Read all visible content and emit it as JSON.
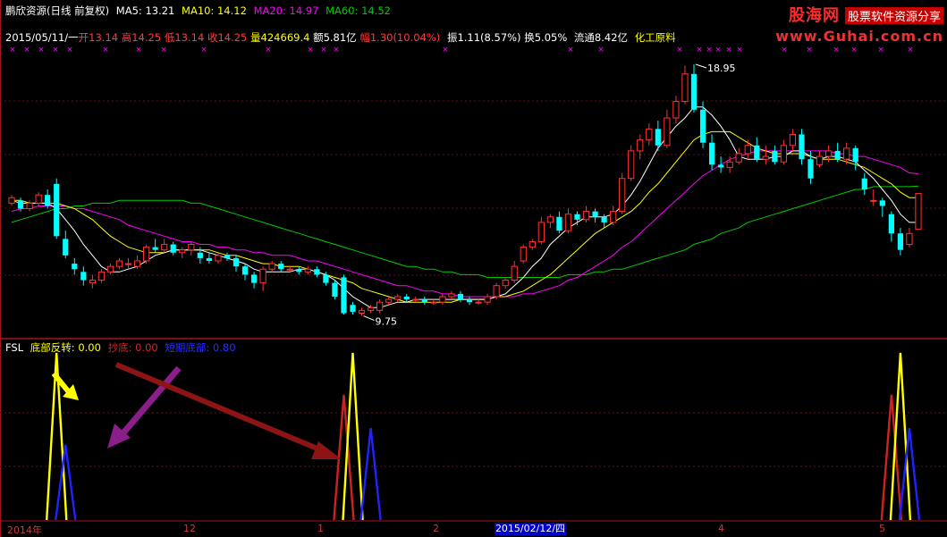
{
  "header": {
    "name": "鹏欣资源(日线 前复权)",
    "ma5_label": "MA5:",
    "ma5": "13.21",
    "ma10_label": "MA10:",
    "ma10": "14.12",
    "ma20_label": "MA20:",
    "ma20": "14.97",
    "ma60_label": "MA60:",
    "ma60": "14.52",
    "colors": {
      "ma5": "#ffffff",
      "ma10": "#ffff00",
      "ma20": "#ff00ff",
      "ma60": "#00cc00"
    }
  },
  "info": {
    "date": "2015/05/11/一",
    "open_label": "开",
    "open": "13.14",
    "high_label": "高",
    "high": "14.25",
    "low_label": "低",
    "low": "13.14",
    "close_label": "收",
    "close": "14.25",
    "vol_label": "量",
    "vol": "424669.4",
    "amt_label": "额",
    "amt": "5.81亿",
    "chg_label": "幅",
    "chg": "1.30(10.04%)",
    "amp_label": "振",
    "amp": "1.11(8.57%)",
    "turn_label": "换",
    "turn": "5.05%",
    "float_label": "流通",
    "float": "8.42亿",
    "sector": "化工原料"
  },
  "price_marks": {
    "high": "18.95",
    "low": "9.75"
  },
  "indicator": {
    "name": "FSL",
    "l1_label": "底部反转:",
    "l1": "0.00",
    "l2_label": "抄底:",
    "l2": "0.00",
    "l3_label": "短期底部:",
    "l3": "0.80",
    "colors": {
      "l1": "#ffff00",
      "l2": "#cc2222",
      "l3": "#2222ff"
    }
  },
  "watermark": {
    "brand": "股海网",
    "slogan": "股票软件资源分享",
    "url": "www.Guhai.com.cn"
  },
  "x_axis": {
    "labels": [
      {
        "text": "2014年",
        "x": 8
      },
      {
        "text": "12",
        "x": 205
      },
      {
        "text": "1",
        "x": 355
      },
      {
        "text": "2",
        "x": 484
      },
      {
        "text": "4",
        "x": 803
      },
      {
        "text": "5",
        "x": 983
      }
    ],
    "cursor_label": "2015/02/12/四"
  },
  "chart_data": {
    "type": "candlestick",
    "price_range": [
      9.2,
      19.6
    ],
    "candles": [
      [
        13.9,
        14.1,
        14.2,
        13.8
      ],
      [
        14.0,
        13.7,
        14.1,
        13.6
      ],
      [
        13.7,
        13.9,
        14.0,
        13.6
      ],
      [
        13.9,
        14.2,
        14.3,
        13.8
      ],
      [
        14.2,
        13.8,
        14.4,
        13.7
      ],
      [
        14.6,
        12.7,
        14.8,
        12.6
      ],
      [
        12.6,
        12.0,
        12.9,
        11.9
      ],
      [
        11.7,
        11.5,
        11.9,
        11.3
      ],
      [
        11.4,
        11.1,
        11.6,
        10.9
      ],
      [
        11.0,
        11.1,
        11.3,
        10.8
      ],
      [
        11.1,
        11.4,
        11.5,
        11.0
      ],
      [
        11.4,
        11.6,
        11.7,
        11.3
      ],
      [
        11.6,
        11.8,
        11.9,
        11.5
      ],
      [
        11.7,
        11.7,
        11.9,
        11.5
      ],
      [
        11.6,
        11.8,
        12.0,
        11.5
      ],
      [
        11.8,
        12.3,
        12.4,
        11.7
      ],
      [
        12.3,
        12.2,
        12.6,
        12.1
      ],
      [
        12.2,
        12.4,
        12.6,
        12.1
      ],
      [
        12.4,
        12.1,
        12.5,
        12.0
      ],
      [
        12.1,
        12.2,
        12.3,
        11.9
      ],
      [
        12.2,
        12.4,
        12.5,
        12.0
      ],
      [
        12.1,
        11.9,
        12.3,
        11.7
      ],
      [
        11.9,
        11.8,
        12.1,
        11.7
      ],
      [
        11.8,
        12.0,
        12.1,
        11.7
      ],
      [
        12.0,
        11.9,
        12.1,
        11.8
      ],
      [
        11.9,
        11.6,
        12.0,
        11.4
      ],
      [
        11.6,
        11.3,
        11.7,
        11.1
      ],
      [
        11.3,
        11.0,
        11.4,
        10.8
      ],
      [
        11.0,
        11.5,
        11.6,
        10.7
      ],
      [
        11.5,
        11.7,
        11.8,
        11.4
      ],
      [
        11.7,
        11.5,
        11.8,
        11.4
      ],
      [
        11.5,
        11.5,
        11.6,
        11.4
      ],
      [
        11.5,
        11.4,
        11.6,
        11.3
      ],
      [
        11.4,
        11.5,
        11.6,
        11.3
      ],
      [
        11.5,
        11.3,
        11.6,
        11.2
      ],
      [
        11.3,
        11.0,
        11.4,
        10.9
      ],
      [
        11.0,
        10.5,
        11.1,
        10.4
      ],
      [
        11.2,
        9.9,
        11.3,
        9.85
      ],
      [
        10.2,
        9.95,
        10.3,
        9.85
      ],
      [
        9.9,
        10.0,
        10.1,
        9.8
      ],
      [
        10.0,
        10.1,
        10.2,
        9.9
      ],
      [
        10.0,
        10.3,
        10.4,
        9.9
      ],
      [
        10.3,
        10.4,
        10.5,
        10.2
      ],
      [
        10.4,
        10.5,
        10.6,
        10.3
      ],
      [
        10.5,
        10.4,
        10.6,
        10.3
      ],
      [
        10.4,
        10.4,
        10.5,
        10.3
      ],
      [
        10.4,
        10.3,
        10.5,
        10.2
      ],
      [
        10.3,
        10.3,
        10.4,
        10.2
      ],
      [
        10.3,
        10.5,
        10.6,
        10.2
      ],
      [
        10.5,
        10.6,
        10.7,
        10.4
      ],
      [
        10.6,
        10.4,
        10.7,
        10.3
      ],
      [
        10.4,
        10.3,
        10.5,
        10.2
      ],
      [
        10.3,
        10.3,
        10.4,
        10.2
      ],
      [
        10.3,
        10.5,
        10.6,
        10.2
      ],
      [
        10.5,
        10.9,
        11.0,
        10.4
      ],
      [
        10.9,
        11.1,
        11.2,
        10.8
      ],
      [
        11.1,
        11.6,
        11.8,
        11.0
      ],
      [
        11.8,
        12.3,
        12.4,
        11.7
      ],
      [
        12.3,
        12.5,
        12.6,
        12.2
      ],
      [
        12.5,
        13.2,
        13.4,
        12.4
      ],
      [
        13.2,
        13.4,
        13.5,
        13.0
      ],
      [
        13.4,
        12.9,
        13.6,
        12.8
      ],
      [
        12.9,
        13.5,
        13.7,
        12.8
      ],
      [
        13.5,
        13.3,
        13.6,
        13.1
      ],
      [
        13.3,
        13.6,
        13.8,
        13.2
      ],
      [
        13.6,
        13.4,
        13.7,
        13.2
      ],
      [
        13.4,
        13.2,
        13.5,
        13.0
      ],
      [
        13.2,
        13.6,
        13.8,
        13.1
      ],
      [
        13.6,
        14.8,
        15.0,
        13.5
      ],
      [
        14.8,
        15.8,
        16.0,
        14.7
      ],
      [
        15.8,
        16.2,
        16.4,
        15.5
      ],
      [
        16.2,
        16.6,
        16.8,
        16.0
      ],
      [
        16.6,
        16.0,
        16.9,
        15.8
      ],
      [
        16.0,
        17.0,
        17.3,
        15.9
      ],
      [
        17.0,
        17.6,
        17.8,
        16.8
      ],
      [
        17.6,
        18.6,
        18.9,
        17.5
      ],
      [
        18.6,
        17.3,
        18.95,
        17.2
      ],
      [
        17.3,
        16.1,
        17.6,
        15.9
      ],
      [
        16.1,
        15.3,
        16.4,
        15.1
      ],
      [
        15.3,
        15.2,
        15.6,
        15.0
      ],
      [
        15.2,
        15.4,
        15.6,
        15.0
      ],
      [
        15.4,
        15.7,
        15.9,
        15.3
      ],
      [
        15.7,
        16.0,
        16.2,
        15.5
      ],
      [
        16.0,
        15.5,
        16.3,
        15.4
      ],
      [
        15.5,
        15.6,
        16.0,
        15.3
      ],
      [
        15.8,
        15.4,
        16.0,
        15.3
      ],
      [
        15.4,
        16.0,
        16.2,
        15.3
      ],
      [
        16.0,
        16.4,
        16.6,
        15.8
      ],
      [
        16.4,
        15.5,
        16.6,
        15.3
      ],
      [
        15.5,
        14.8,
        15.8,
        14.6
      ],
      [
        15.3,
        15.6,
        15.8,
        15.2
      ],
      [
        15.6,
        15.8,
        16.0,
        15.4
      ],
      [
        15.8,
        15.5,
        16.1,
        15.4
      ],
      [
        15.5,
        15.9,
        16.1,
        15.3
      ],
      [
        15.9,
        15.4,
        16.0,
        15.1
      ],
      [
        14.8,
        14.4,
        15.0,
        14.2
      ],
      [
        14.0,
        14.0,
        14.4,
        13.8
      ],
      [
        14.0,
        13.8,
        14.1,
        13.4
      ],
      [
        13.5,
        12.8,
        13.6,
        12.5
      ],
      [
        12.8,
        12.2,
        13.0,
        12.0
      ],
      [
        12.4,
        12.8,
        13.0,
        12.3
      ],
      [
        12.95,
        14.25,
        14.25,
        12.95
      ]
    ],
    "ma5": [
      14.0,
      13.9,
      13.9,
      13.9,
      13.9,
      13.7,
      13.3,
      12.9,
      12.4,
      12.0,
      11.6,
      11.4,
      11.4,
      11.5,
      11.6,
      11.8,
      12.0,
      12.1,
      12.2,
      12.2,
      12.2,
      12.2,
      12.1,
      12.0,
      11.9,
      11.8,
      11.7,
      11.5,
      11.4,
      11.4,
      11.4,
      11.4,
      11.5,
      11.5,
      11.4,
      11.3,
      11.1,
      10.8,
      10.5,
      10.3,
      10.1,
      10.1,
      10.2,
      10.3,
      10.3,
      10.4,
      10.4,
      10.4,
      10.4,
      10.4,
      10.4,
      10.4,
      10.4,
      10.4,
      10.5,
      10.6,
      10.9,
      11.2,
      11.6,
      11.9,
      12.4,
      12.7,
      13.0,
      13.2,
      13.4,
      13.4,
      13.4,
      13.5,
      13.8,
      14.2,
      14.7,
      15.3,
      15.9,
      16.3,
      16.7,
      17.0,
      17.4,
      17.4,
      17.1,
      16.7,
      16.2,
      15.6,
      15.5,
      15.5,
      15.5,
      15.6,
      15.6,
      15.8,
      15.8,
      15.6,
      15.5,
      15.6,
      15.6,
      15.5,
      15.4,
      15.1,
      14.8,
      14.4,
      14.0,
      13.5,
      13.2,
      13.2
    ],
    "ma10": [
      14.0,
      14.0,
      13.9,
      13.9,
      13.9,
      13.9,
      13.8,
      13.7,
      13.5,
      13.3,
      13.0,
      12.7,
      12.5,
      12.3,
      12.2,
      12.1,
      12.1,
      12.1,
      12.2,
      12.2,
      12.2,
      12.2,
      12.2,
      12.1,
      12.0,
      12.0,
      11.9,
      11.8,
      11.7,
      11.7,
      11.6,
      11.6,
      11.6,
      11.5,
      11.4,
      11.3,
      11.2,
      11.1,
      11.0,
      10.8,
      10.7,
      10.6,
      10.5,
      10.4,
      10.3,
      10.3,
      10.3,
      10.3,
      10.3,
      10.3,
      10.4,
      10.4,
      10.4,
      10.4,
      10.5,
      10.5,
      10.6,
      10.7,
      10.9,
      11.1,
      11.3,
      11.6,
      11.9,
      12.2,
      12.5,
      12.8,
      13.0,
      13.2,
      13.4,
      13.6,
      13.9,
      14.3,
      14.6,
      15.0,
      15.4,
      15.8,
      16.2,
      16.4,
      16.5,
      16.5,
      16.5,
      16.3,
      16.1,
      15.9,
      15.8,
      15.7,
      15.7,
      15.7,
      15.7,
      15.6,
      15.5,
      15.5,
      15.5,
      15.4,
      15.3,
      15.2,
      15.0,
      14.8,
      14.6,
      14.3,
      14.1,
      14.1
    ],
    "ma20": [
      13.6,
      13.7,
      13.7,
      13.8,
      13.8,
      13.8,
      13.8,
      13.7,
      13.7,
      13.6,
      13.5,
      13.4,
      13.3,
      13.1,
      13.0,
      12.9,
      12.8,
      12.7,
      12.6,
      12.5,
      12.5,
      12.4,
      12.4,
      12.3,
      12.3,
      12.2,
      12.2,
      12.1,
      12.1,
      12.0,
      12.0,
      12.0,
      11.9,
      11.8,
      11.8,
      11.7,
      11.6,
      11.5,
      11.4,
      11.3,
      11.2,
      11.1,
      11.0,
      10.9,
      10.9,
      10.8,
      10.7,
      10.7,
      10.6,
      10.6,
      10.5,
      10.5,
      10.5,
      10.5,
      10.5,
      10.5,
      10.5,
      10.6,
      10.6,
      10.7,
      10.8,
      10.9,
      11.1,
      11.2,
      11.4,
      11.6,
      11.8,
      12.0,
      12.3,
      12.5,
      12.8,
      13.1,
      13.4,
      13.7,
      14.0,
      14.3,
      14.6,
      14.9,
      15.1,
      15.3,
      15.5,
      15.6,
      15.7,
      15.8,
      15.8,
      15.8,
      15.8,
      15.8,
      15.8,
      15.8,
      15.8,
      15.8,
      15.7,
      15.7,
      15.6,
      15.6,
      15.5,
      15.4,
      15.3,
      15.2,
      15.0,
      14.97
    ],
    "ma60": [
      13.2,
      13.3,
      13.4,
      13.5,
      13.6,
      13.7,
      13.7,
      13.8,
      13.8,
      13.9,
      13.9,
      13.9,
      14.0,
      14.0,
      14.0,
      14.0,
      14.0,
      14.0,
      14.0,
      14.0,
      13.9,
      13.9,
      13.8,
      13.7,
      13.6,
      13.5,
      13.4,
      13.3,
      13.2,
      13.1,
      13.0,
      12.9,
      12.8,
      12.7,
      12.6,
      12.5,
      12.4,
      12.3,
      12.2,
      12.1,
      12.0,
      11.9,
      11.8,
      11.7,
      11.6,
      11.6,
      11.5,
      11.5,
      11.4,
      11.4,
      11.3,
      11.3,
      11.3,
      11.2,
      11.2,
      11.2,
      11.2,
      11.2,
      11.2,
      11.2,
      11.2,
      11.2,
      11.3,
      11.3,
      11.3,
      11.4,
      11.4,
      11.5,
      11.5,
      11.6,
      11.7,
      11.8,
      11.9,
      12.0,
      12.1,
      12.2,
      12.4,
      12.5,
      12.6,
      12.8,
      12.9,
      13.0,
      13.2,
      13.3,
      13.4,
      13.5,
      13.6,
      13.7,
      13.8,
      13.9,
      14.0,
      14.1,
      14.2,
      14.3,
      14.4,
      14.4,
      14.5,
      14.5,
      14.5,
      14.5,
      14.5,
      14.52
    ],
    "signals": [
      {
        "series": "底部反转",
        "index": 5,
        "value": 1.0
      },
      {
        "series": "短期底部",
        "index": 6,
        "value": 0.45
      },
      {
        "series": "抄底",
        "index": 37,
        "value": 0.75
      },
      {
        "series": "底部反转",
        "index": 38,
        "value": 1.0
      },
      {
        "series": "短期底部",
        "index": 40,
        "value": 0.55
      },
      {
        "series": "抄底",
        "index": 98,
        "value": 0.75
      },
      {
        "series": "底部反转",
        "index": 99,
        "value": 1.0
      },
      {
        "series": "短期底部",
        "index": 100,
        "value": 0.55
      }
    ]
  }
}
